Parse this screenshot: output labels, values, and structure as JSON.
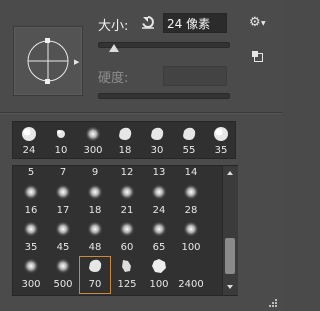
{
  "brush_options": {
    "size_label": "大小:",
    "size_value": "24 像素",
    "size_slider_fraction": 0.12,
    "hardness_label": "硬度:",
    "hardness_value": "",
    "hardness_slider_fraction": 0.0
  },
  "recent_brushes": [
    {
      "label": "24",
      "kind": "hard-round"
    },
    {
      "label": "10",
      "kind": "hard-round-small"
    },
    {
      "label": "300",
      "kind": "soft-round"
    },
    {
      "label": "18",
      "kind": "hard-chalk"
    },
    {
      "label": "30",
      "kind": "hard-chalk"
    },
    {
      "label": "55",
      "kind": "hard-chalk"
    },
    {
      "label": "35",
      "kind": "hard-round"
    }
  ],
  "brush_grid": [
    {
      "label": "5",
      "kind": "none"
    },
    {
      "label": "7",
      "kind": "none"
    },
    {
      "label": "9",
      "kind": "none"
    },
    {
      "label": "12",
      "kind": "none"
    },
    {
      "label": "13",
      "kind": "none"
    },
    {
      "label": "14",
      "kind": "none"
    },
    {
      "label": "16",
      "kind": "soft-round"
    },
    {
      "label": "17",
      "kind": "soft-round"
    },
    {
      "label": "18",
      "kind": "soft-round"
    },
    {
      "label": "21",
      "kind": "soft-round"
    },
    {
      "label": "24",
      "kind": "soft-round"
    },
    {
      "label": "28",
      "kind": "soft-round"
    },
    {
      "label": "35",
      "kind": "soft-round"
    },
    {
      "label": "45",
      "kind": "soft-round"
    },
    {
      "label": "48",
      "kind": "soft-round"
    },
    {
      "label": "60",
      "kind": "soft-round"
    },
    {
      "label": "65",
      "kind": "soft-round"
    },
    {
      "label": "100",
      "kind": "soft-round"
    },
    {
      "label": "300",
      "kind": "soft-round"
    },
    {
      "label": "500",
      "kind": "soft-round"
    },
    {
      "label": "70",
      "kind": "hard-chalk",
      "selected": true
    },
    {
      "label": "125",
      "kind": "chalk-streak"
    },
    {
      "label": "100",
      "kind": "hard-polygon"
    },
    {
      "label": "2400",
      "kind": "none"
    }
  ],
  "icons": {
    "reset": "reset-size-icon",
    "settings": "gear-icon",
    "new_preset": "new-preset-icon",
    "preview_menu": "triangle-right-icon"
  },
  "colors": {
    "panel_bg": "#4b4b4b",
    "well_bg": "#313131",
    "selection": "#c98a3a"
  }
}
